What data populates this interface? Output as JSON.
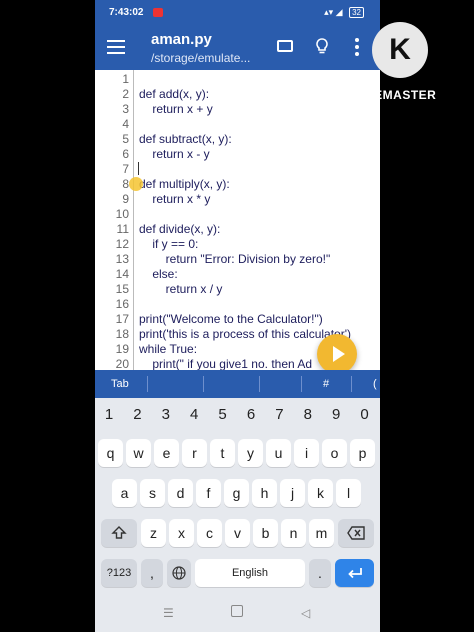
{
  "status": {
    "time": "7:43:02",
    "battery": "32"
  },
  "appbar": {
    "title": "aman.py",
    "subtitle": "/storage/emulate..."
  },
  "editor": {
    "lines": [
      {
        "num": "1",
        "code": ""
      },
      {
        "num": "2",
        "code": "def add(x, y):"
      },
      {
        "num": "3",
        "code": "    return x + y"
      },
      {
        "num": "4",
        "code": ""
      },
      {
        "num": "5",
        "code": "def subtract(x, y):"
      },
      {
        "num": "6",
        "code": "    return x - y"
      },
      {
        "num": "7",
        "code": ""
      },
      {
        "num": "8",
        "code": "def multiply(x, y):"
      },
      {
        "num": "9",
        "code": "    return x * y"
      },
      {
        "num": "10",
        "code": ""
      },
      {
        "num": "11",
        "code": "def divide(x, y):"
      },
      {
        "num": "12",
        "code": "    if y == 0:"
      },
      {
        "num": "13",
        "code": "        return \"Error: Division by zero!\""
      },
      {
        "num": "14",
        "code": "    else:"
      },
      {
        "num": "15",
        "code": "        return x / y"
      },
      {
        "num": "16",
        "code": ""
      },
      {
        "num": "17",
        "code": "print(\"Welcome to the Calculator!\")"
      },
      {
        "num": "18",
        "code": "print('this is a process of this calculator')"
      },
      {
        "num": "19",
        "code": "while True:"
      },
      {
        "num": "20",
        "code": "    print(\" if you give1 no. then Ad"
      }
    ]
  },
  "symbols": {
    "tab": "Tab",
    "hash": "#",
    "paren": "("
  },
  "keyboard": {
    "numbers": [
      "1",
      "2",
      "3",
      "4",
      "5",
      "6",
      "7",
      "8",
      "9",
      "0"
    ],
    "row1": [
      "q",
      "w",
      "e",
      "r",
      "t",
      "y",
      "u",
      "i",
      "o",
      "p"
    ],
    "row2": [
      "a",
      "s",
      "d",
      "f",
      "g",
      "h",
      "j",
      "k",
      "l"
    ],
    "row3": [
      "z",
      "x",
      "c",
      "v",
      "b",
      "n",
      "m"
    ],
    "mode_key": "?123",
    "comma": ",",
    "space_label": "English",
    "period": ".",
    "shift_icon": "shift-icon",
    "backspace_icon": "backspace-icon",
    "globe_icon": "globe-icon",
    "enter_icon": "enter-icon"
  },
  "watermark": {
    "logo_letter": "K",
    "text": "KINEMASTER"
  },
  "colors": {
    "primary": "#2a5cad",
    "accent": "#f2b830",
    "enter": "#2f84e8"
  }
}
